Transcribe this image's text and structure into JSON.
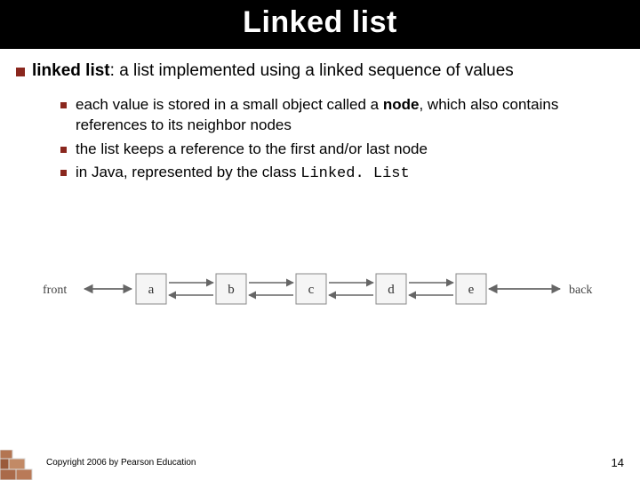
{
  "title": "Linked list",
  "main_bullet": {
    "term": "linked list",
    "rest": ": a list implemented using a linked sequence of values"
  },
  "sub_bullets": [
    {
      "pre": "each value is stored in a small object called a ",
      "term": "node",
      "post": ", which also contains references to its neighbor nodes"
    },
    {
      "pre": "the list keeps a reference to the first and/or last node",
      "term": "",
      "post": ""
    },
    {
      "pre": "in Java, represented by the class ",
      "code": "Linked. List",
      "post": ""
    }
  ],
  "diagram": {
    "front_label": "front",
    "back_label": "back",
    "nodes": [
      "a",
      "b",
      "c",
      "d",
      "e"
    ]
  },
  "footer": {
    "copyright": "Copyright 2006 by Pearson Education",
    "page": "14"
  }
}
